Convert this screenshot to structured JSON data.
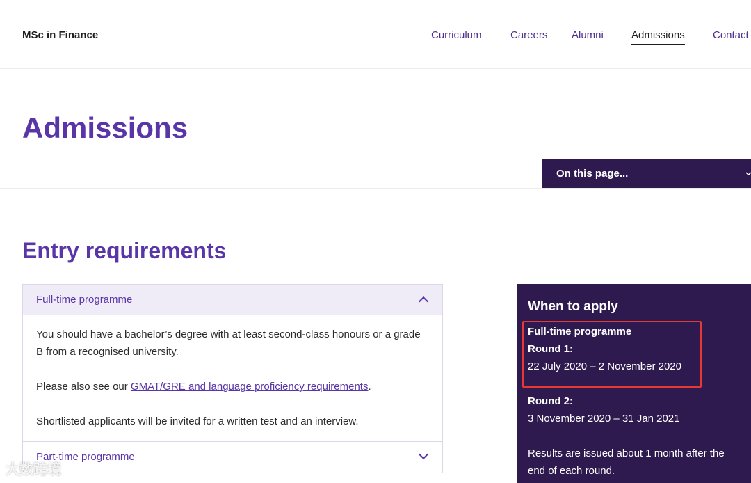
{
  "header": {
    "site_title": "MSc in Finance",
    "nav": [
      {
        "label": "Curriculum",
        "active": false
      },
      {
        "label": "Careers",
        "active": false
      },
      {
        "label": "Alumni",
        "active": false
      },
      {
        "label": "Admissions",
        "active": true
      },
      {
        "label": "Contact",
        "active": false
      }
    ]
  },
  "hero": {
    "title": "Admissions",
    "on_this_page": "On this page..."
  },
  "entry": {
    "title": "Entry requirements",
    "accordion": [
      {
        "title": "Full-time programme",
        "expanded": true,
        "p1": "You should have a bachelor’s degree with at least second-class honours or a grade B from a recognised university.",
        "p2_before": "Please also see our ",
        "p2_link": "GMAT/GRE and language proficiency requirements",
        "p2_after": ".",
        "p3": "Shortlisted applicants will be invited for a written test and an interview."
      },
      {
        "title": "Part-time programme",
        "expanded": false
      }
    ]
  },
  "apply": {
    "title": "When to apply",
    "programme": "Full-time programme",
    "round1_label": "Round 1:",
    "round1_dates": "22 July 2020 – 2 November 2020",
    "round2_label": "Round 2:",
    "round2_dates": "3 November 2020 – 31 Jan 2021",
    "results": "Results are issued about 1 month after the end of each round."
  },
  "watermark": "大数跨境",
  "colors": {
    "brand_purple": "#5a35a8",
    "dark_purple": "#2e1a4f",
    "highlight_red": "#e53935"
  }
}
